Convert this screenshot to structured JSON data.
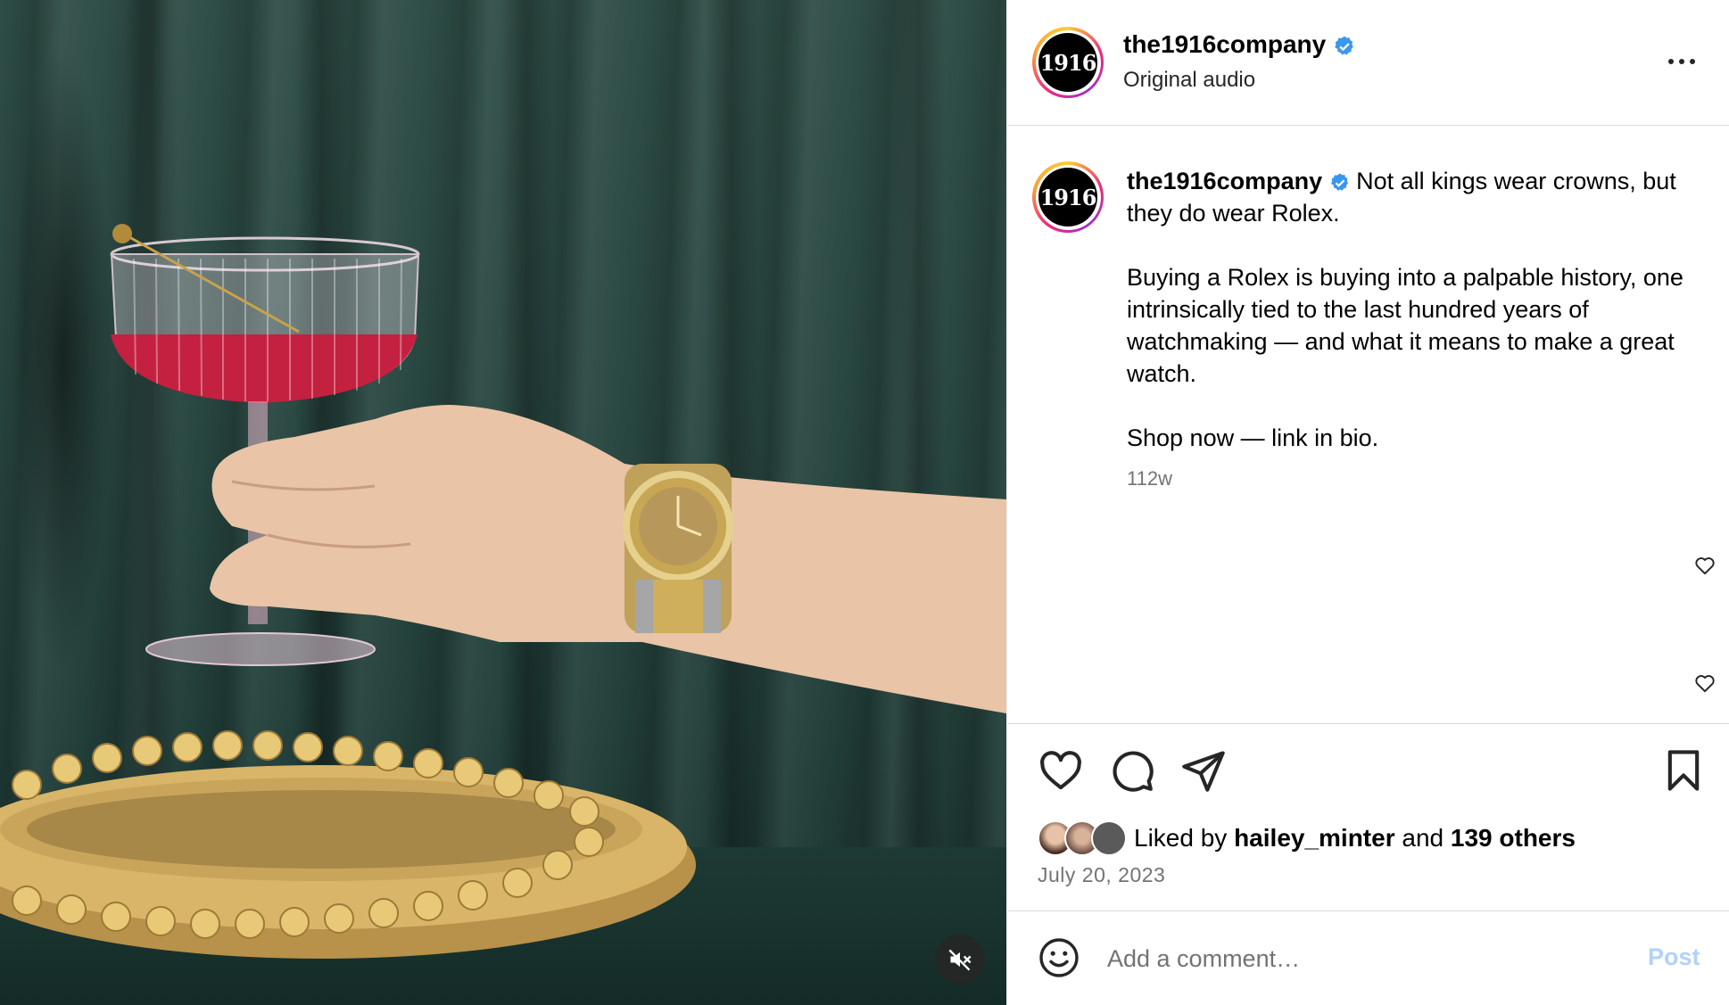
{
  "post": {
    "username": "the1916company",
    "avatar_text": "1916",
    "audio_label": "Original audio",
    "caption_lead": "Not all kings wear crowns, but they do wear Rolex.",
    "caption_body": "Buying a Rolex is buying into a palpable history, one intrinsically tied to the last hundred years of watchmaking — and what it means to make a great watch.",
    "caption_cta": "Shop now — link in bio.",
    "time_ago": "112w",
    "liked_by_prefix": "Liked by",
    "liked_by_user": "hailey_minter",
    "liked_by_and": "and",
    "liked_by_others": "139 others",
    "date": "July 20, 2023"
  },
  "comment_box": {
    "placeholder": "Add a comment…",
    "post_label": "Post"
  },
  "colors": {
    "verified": "#3897f0",
    "post_button_disabled": "#b3d1f8",
    "muted_text": "#737373"
  },
  "icons": {
    "media_mute": "speaker-muted-icon",
    "like": "heart-icon",
    "comment": "comment-bubble-icon",
    "share": "paper-plane-icon",
    "save": "bookmark-icon",
    "more": "more-dots-icon",
    "emoji": "emoji-icon"
  }
}
